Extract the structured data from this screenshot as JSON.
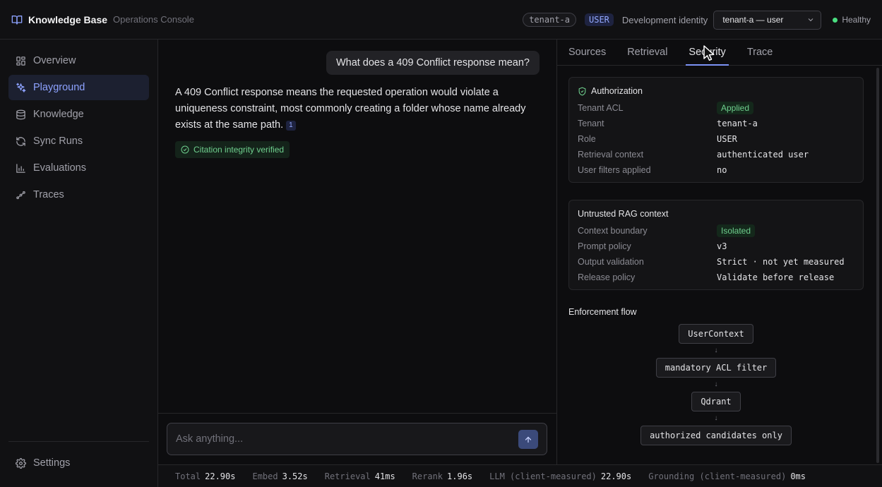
{
  "header": {
    "title": "Knowledge Base",
    "subtitle": "Operations Console",
    "tenant_pill": "tenant-a",
    "role_pill": "USER",
    "identity_label": "Development identity",
    "identity_select": "tenant-a — user",
    "health": "Healthy"
  },
  "sidebar": {
    "items": [
      {
        "label": "Overview",
        "icon": "grid-icon"
      },
      {
        "label": "Playground",
        "icon": "sparkles-icon",
        "active": true
      },
      {
        "label": "Knowledge",
        "icon": "database-icon"
      },
      {
        "label": "Sync Runs",
        "icon": "refresh-icon"
      },
      {
        "label": "Evaluations",
        "icon": "bar-chart-icon"
      },
      {
        "label": "Traces",
        "icon": "waypoints-icon"
      }
    ],
    "settings_label": "Settings"
  },
  "chat": {
    "user_message": "What does a 409 Conflict response mean?",
    "answer": "A 409 Conflict response means the requested operation would violate a uniqueness constraint, most commonly creating a folder whose name already exists at the same path.",
    "citation": "1",
    "verified_label": "Citation integrity verified",
    "composer_placeholder": "Ask anything..."
  },
  "panel": {
    "tabs": [
      "Sources",
      "Retrieval",
      "Security",
      "Trace"
    ],
    "active_tab": "Security",
    "authorization": {
      "title": "Authorization",
      "rows": [
        {
          "k": "Tenant ACL",
          "v": "Applied",
          "badge": true
        },
        {
          "k": "Tenant",
          "v": "tenant-a"
        },
        {
          "k": "Role",
          "v": "USER"
        },
        {
          "k": "Retrieval context",
          "v": "authenticated user"
        },
        {
          "k": "User filters applied",
          "v": "no"
        }
      ]
    },
    "rag": {
      "title": "Untrusted RAG context",
      "rows": [
        {
          "k": "Context boundary",
          "v": "Isolated",
          "badge": true
        },
        {
          "k": "Prompt policy",
          "v": "v3"
        },
        {
          "k": "Output validation",
          "v": "Strict · not yet measured"
        },
        {
          "k": "Release policy",
          "v": "Validate before release"
        }
      ]
    },
    "flow": {
      "title": "Enforcement flow",
      "nodes": [
        "UserContext",
        "mandatory ACL filter",
        "Qdrant",
        "authorized candidates only"
      ],
      "arrow": "↓"
    }
  },
  "metrics": [
    {
      "k": "Total",
      "v": "22.90s"
    },
    {
      "k": "Embed",
      "v": "3.52s"
    },
    {
      "k": "Retrieval",
      "v": "41ms"
    },
    {
      "k": "Rerank",
      "v": "1.96s"
    },
    {
      "k": "LLM (client-measured)",
      "v": "22.90s"
    },
    {
      "k": "Grounding (client-measured)",
      "v": "0ms"
    }
  ],
  "colors": {
    "accent": "#8da2ff",
    "success": "#6fcf8e",
    "background": "#0d0d0f"
  }
}
